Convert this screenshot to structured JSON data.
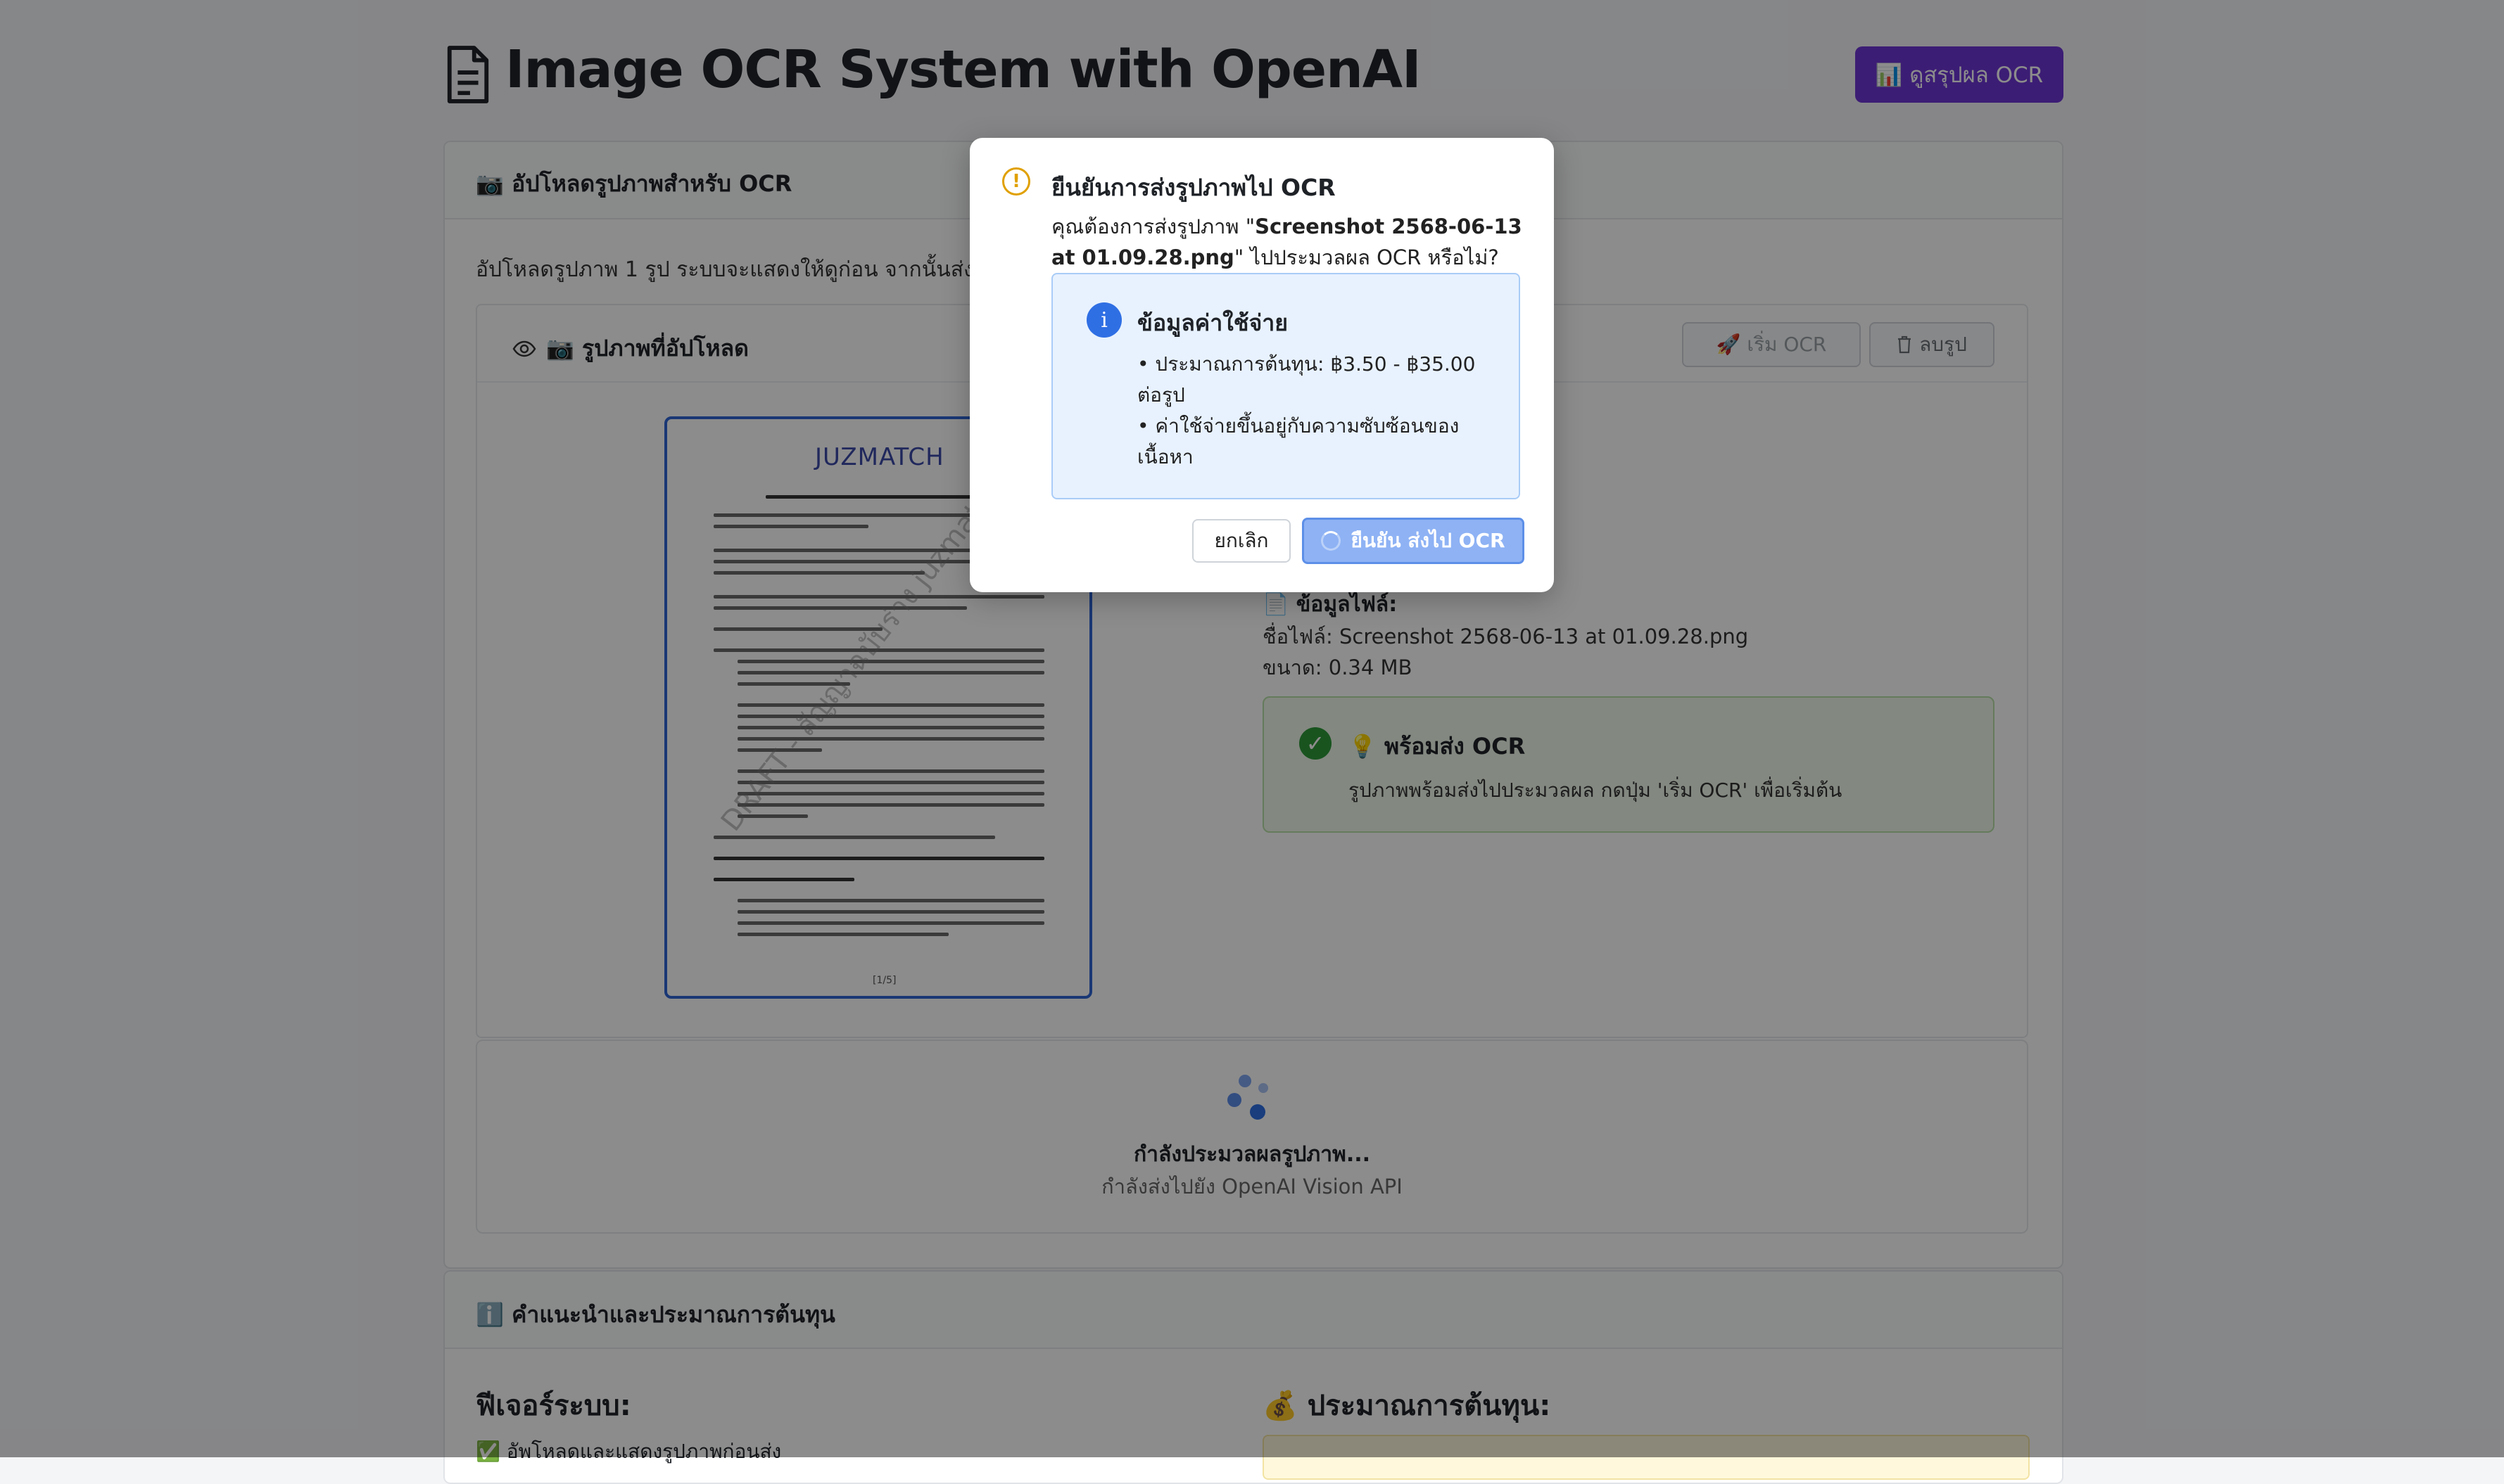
{
  "header": {
    "title": "Image OCR System with OpenAI",
    "summary_button": "📊 ดูสรุปผล OCR"
  },
  "upload_card": {
    "heading": "📷 อัปโหลดรูปภาพสำหรับ OCR",
    "intro": "อัปโหลดรูปภาพ 1 รูป ระบบจะแสดงให้ดูก่อน จากนั้นส่งไปยัง OpenAI Vision API"
  },
  "preview": {
    "heading": "📷 รูปภาพที่อัปโหลด",
    "start_button": "🚀 เริ่ม OCR",
    "delete_button": "ลบรูป",
    "doc_logo": "JUZMATCH",
    "doc_watermark": "DRAFT - สัญญาฉบับร่าง juzmatch",
    "doc_page": "[1/5]"
  },
  "file_info": {
    "heading": "📄 ข้อมูลไฟล์:",
    "name": "ชื่อไฟล์: Screenshot 2568-06-13 at 01.09.28.png",
    "size": "ขนาด: 0.34 MB"
  },
  "ready": {
    "check": "✓",
    "title": "💡 พร้อมส่ง OCR",
    "message": "รูปภาพพร้อมส่งไปประมวลผล กดปุ่ม 'เริ่ม OCR' เพื่อเริ่มต้น"
  },
  "loading": {
    "title": "กำลังประมวลผลรูปภาพ...",
    "subtitle": "กำลังส่งไปยัง OpenAI Vision API"
  },
  "guide_card": {
    "heading": "ℹ️ คำแนะนำและประมาณการต้นทุน",
    "features_title": "ฟีเจอร์ระบบ:",
    "feature_1": "✅ อัพโหลดและแสดงรูปภาพก่อนส่ง",
    "cost_title": "💰 ประมาณการต้นทุน:"
  },
  "modal": {
    "warn_icon": "!",
    "title": "ยืนยันการส่งรูปภาพไป OCR",
    "msg_prefix": "คุณต้องการส่งรูปภาพ \"",
    "msg_filename": "Screenshot 2568-06-13 at 01.09.28.png",
    "msg_suffix": "\" ไปประมวลผล OCR หรือไม่?",
    "info_icon": "i",
    "info_title": "ข้อมูลค่าใช้จ่าย",
    "info_line_1": "• ประมาณการต้นทุน: ฿3.50 - ฿35.00 ต่อรูป",
    "info_line_2": "• ค่าใช้จ่ายขึ้นอยู่กับความซับซ้อนของเนื้อหา",
    "cancel_button": "ยกเลิก",
    "confirm_button": "ยืนยัน ส่งไป OCR"
  }
}
